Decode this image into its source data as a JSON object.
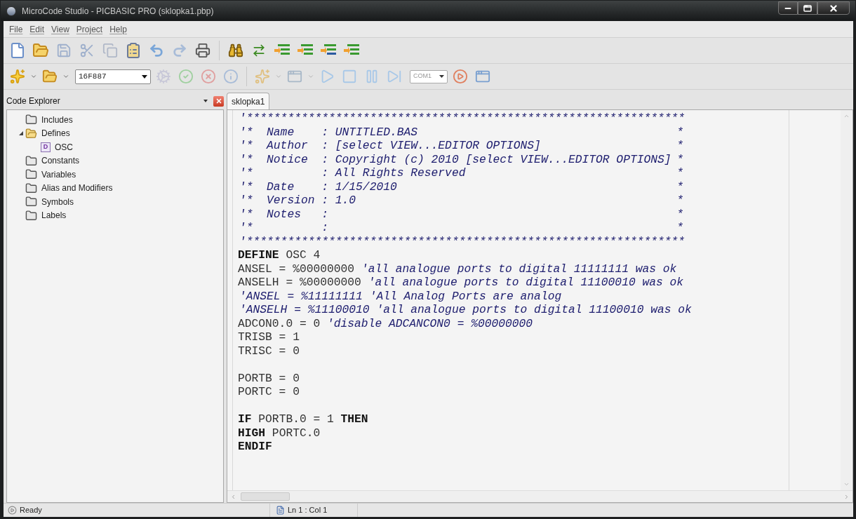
{
  "window": {
    "title": "MicroCode Studio - PICBASIC PRO (sklopka1.pbp)"
  },
  "menu": [
    "File",
    "Edit",
    "View",
    "Project",
    "Help"
  ],
  "device": {
    "value": "16F887"
  },
  "port": {
    "value": "COM1"
  },
  "explorer": {
    "title": "Code Explorer",
    "items": [
      {
        "label": "Includes",
        "kind": "folder",
        "expanded": false
      },
      {
        "label": "Defines",
        "kind": "folder",
        "expanded": true,
        "children": [
          {
            "label": "OSC",
            "kind": "define",
            "badge": "D"
          }
        ]
      },
      {
        "label": "Constants",
        "kind": "folder",
        "expanded": false
      },
      {
        "label": "Variables",
        "kind": "folder",
        "expanded": false
      },
      {
        "label": "Alias and Modifiers",
        "kind": "folder",
        "expanded": false
      },
      {
        "label": "Symbols",
        "kind": "folder",
        "expanded": false
      },
      {
        "label": "Labels",
        "kind": "folder",
        "expanded": false
      }
    ]
  },
  "tabs": [
    {
      "label": "sklopka1",
      "selected": true
    }
  ],
  "code": [
    {
      "kind": "line",
      "segments": [
        {
          "kind": "comment",
          "text": "'****************************************************************"
        }
      ]
    },
    {
      "kind": "box",
      "text": "'*  Name    : UNTITLED.BAS",
      "end": "*"
    },
    {
      "kind": "box",
      "text": "'*  Author  : [select VIEW...EDITOR OPTIONS]",
      "end": "*"
    },
    {
      "kind": "box",
      "text": "'*  Notice  : Copyright (c) 2010 [select VIEW...EDITOR OPTIONS]",
      "end": "*"
    },
    {
      "kind": "box",
      "text": "'*          : All Rights Reserved",
      "end": "*"
    },
    {
      "kind": "box",
      "text": "'*  Date    : 1/15/2010",
      "end": "*"
    },
    {
      "kind": "box",
      "text": "'*  Version : 1.0",
      "end": "*"
    },
    {
      "kind": "box",
      "text": "'*  Notes   :",
      "end": "*"
    },
    {
      "kind": "box",
      "text": "'*          :",
      "end": "*"
    },
    {
      "kind": "line",
      "segments": [
        {
          "kind": "comment",
          "text": "'****************************************************************"
        }
      ]
    },
    {
      "kind": "line",
      "segments": [
        {
          "kind": "keyword",
          "text": "DEFINE"
        },
        {
          "kind": "plain",
          "text": " OSC 4"
        }
      ]
    },
    {
      "kind": "line",
      "segments": [
        {
          "kind": "plain",
          "text": "ANSEL = %00000000 "
        },
        {
          "kind": "comment",
          "text": "'all analogue ports to digital 11111111 was ok"
        }
      ]
    },
    {
      "kind": "line",
      "segments": [
        {
          "kind": "plain",
          "text": "ANSELH = %00000000 "
        },
        {
          "kind": "comment",
          "text": "'all analogue ports to digital 11100010 was ok"
        }
      ]
    },
    {
      "kind": "line",
      "segments": [
        {
          "kind": "comment",
          "text": "'ANSEL = %11111111 'All Analog Ports are analog"
        }
      ]
    },
    {
      "kind": "line",
      "segments": [
        {
          "kind": "comment",
          "text": "'ANSELH = %11100010 'all analogue ports to digital 11100010 was ok"
        }
      ]
    },
    {
      "kind": "line",
      "segments": [
        {
          "kind": "plain",
          "text": "ADCON0.0 = 0 "
        },
        {
          "kind": "comment",
          "text": "'disable ADCANCON0 = %00000000"
        }
      ]
    },
    {
      "kind": "line",
      "segments": [
        {
          "kind": "plain",
          "text": "TRISB = 1"
        }
      ]
    },
    {
      "kind": "line",
      "segments": [
        {
          "kind": "plain",
          "text": "TRISC = 0"
        }
      ]
    },
    {
      "kind": "blank"
    },
    {
      "kind": "line",
      "segments": [
        {
          "kind": "plain",
          "text": "PORTB = 0"
        }
      ]
    },
    {
      "kind": "line",
      "segments": [
        {
          "kind": "plain",
          "text": "PORTC = 0"
        }
      ]
    },
    {
      "kind": "blank"
    },
    {
      "kind": "line",
      "segments": [
        {
          "kind": "keyword",
          "text": "IF"
        },
        {
          "kind": "plain",
          "text": " PORTB.0 = 1 "
        },
        {
          "kind": "keyword",
          "text": "THEN"
        }
      ]
    },
    {
      "kind": "line",
      "segments": [
        {
          "kind": "keyword",
          "text": "HIGH"
        },
        {
          "kind": "plain",
          "text": " PORTC.0"
        }
      ]
    },
    {
      "kind": "line",
      "segments": [
        {
          "kind": "keyword",
          "text": "ENDIF"
        }
      ]
    }
  ],
  "status": {
    "message": "Ready",
    "position": "Ln 1 : Col 1"
  }
}
